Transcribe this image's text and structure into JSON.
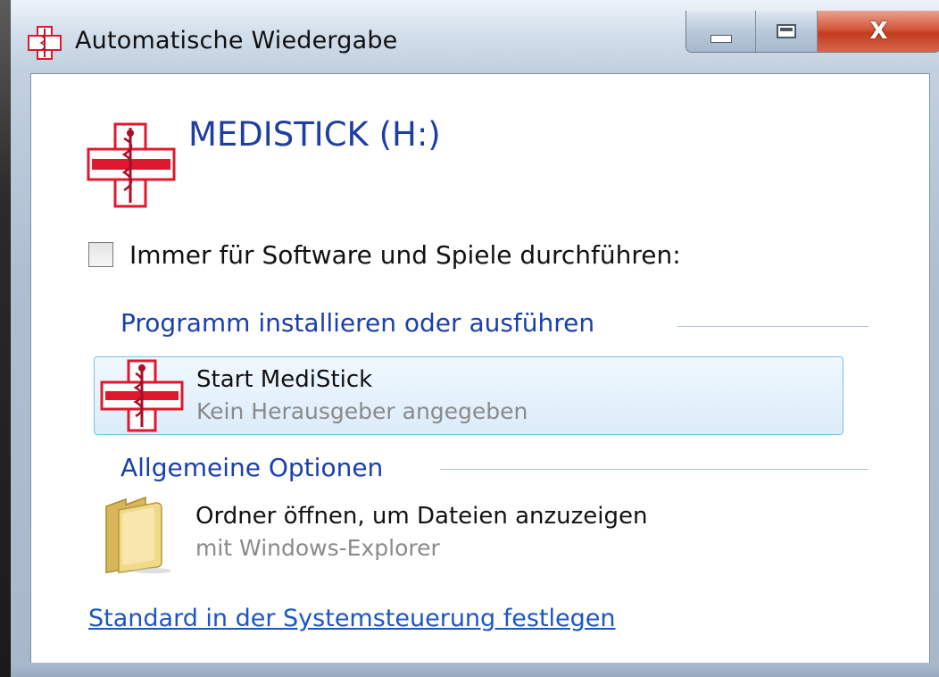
{
  "window": {
    "title": "Automatische Wiedergabe",
    "buttons": {
      "minimize": "–",
      "maximize": "□",
      "close": "X"
    }
  },
  "drive": {
    "label": "MEDISTICK (H:)"
  },
  "always_checkbox": {
    "label": "Immer für Software und Spiele durchführen:",
    "checked": false
  },
  "sections": {
    "install": {
      "title": "Programm installieren oder ausführen",
      "items": [
        {
          "title": "Start MediStick",
          "subtitle": "Kein Herausgeber angegeben",
          "icon": "medistick-cross-icon",
          "selected": true
        }
      ]
    },
    "general": {
      "title": "Allgemeine Optionen",
      "items": [
        {
          "title": "Ordner öffnen, um Dateien anzuzeigen",
          "subtitle": "mit Windows-Explorer",
          "icon": "folder-icon",
          "selected": false
        }
      ]
    }
  },
  "control_panel_link": "Standard in der Systemsteuerung festlegen",
  "colors": {
    "accent_blue": "#1a3fae",
    "link_blue": "#1a56c4",
    "close_red": "#d4573a",
    "medical_cross_red": "#e0182d"
  }
}
